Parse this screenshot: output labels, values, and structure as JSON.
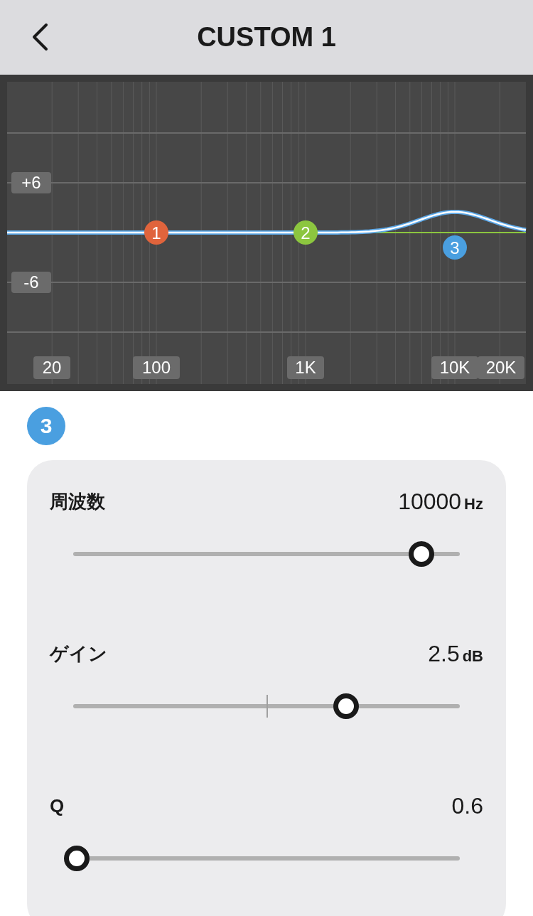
{
  "header": {
    "title": "CUSTOM 1"
  },
  "graph": {
    "gain_labels": [
      "+6",
      "-6"
    ],
    "freq_labels": [
      "20",
      "100",
      "1K",
      "10K",
      "20K"
    ],
    "bands": [
      {
        "label": "1",
        "color": "#e0643c"
      },
      {
        "label": "2",
        "color": "#8cc63f"
      },
      {
        "label": "3",
        "color": "#4a9fe0"
      }
    ]
  },
  "selected_band": {
    "label": "3",
    "color": "#4a9fe0"
  },
  "params": [
    {
      "kind": "unipolar",
      "label": "周波数",
      "value": "10000",
      "unit": "Hz",
      "level": 0.9
    },
    {
      "kind": "bipolar",
      "label": "ゲイン",
      "value": "2.5",
      "unit": "dB",
      "level": 0.706
    },
    {
      "kind": "unipolar",
      "label": "Q",
      "value": "0.6",
      "level": 0.01
    }
  ]
}
